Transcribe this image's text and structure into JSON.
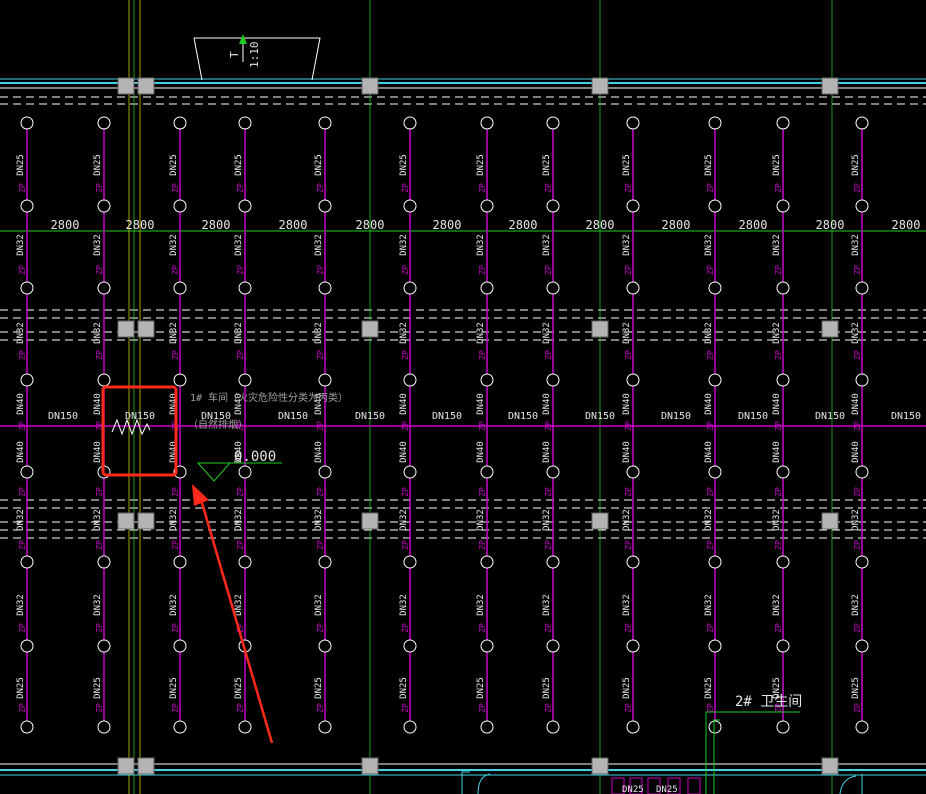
{
  "colors": {
    "background": "#000000",
    "pipe": "#c800c8",
    "grid_green": "#22cc22",
    "wall_cyan": "#46d2e6",
    "column_fill": "#b4b4b4",
    "dash_white": "#ffffff",
    "highlight_red": "#ff2a1a",
    "text_white": "#e6e6e6",
    "text_grey": "#a0a0a0"
  },
  "plan": {
    "grid_spacing_label": "2800",
    "pipe_row_labels": {
      "dn25": "DN25",
      "dn32": "DN32",
      "dn40": "DN40",
      "zp": "ZP",
      "main": "DN150"
    },
    "room_note": "1# 车间（火灾危险性分类为丙类）",
    "room_sub_note": "（自然排烟）",
    "elevation": "0.000",
    "slope": "1:10",
    "slope_letter": "T",
    "washroom": "2# 卫生间",
    "bottom_labels": [
      "DN25",
      "DN25"
    ]
  }
}
